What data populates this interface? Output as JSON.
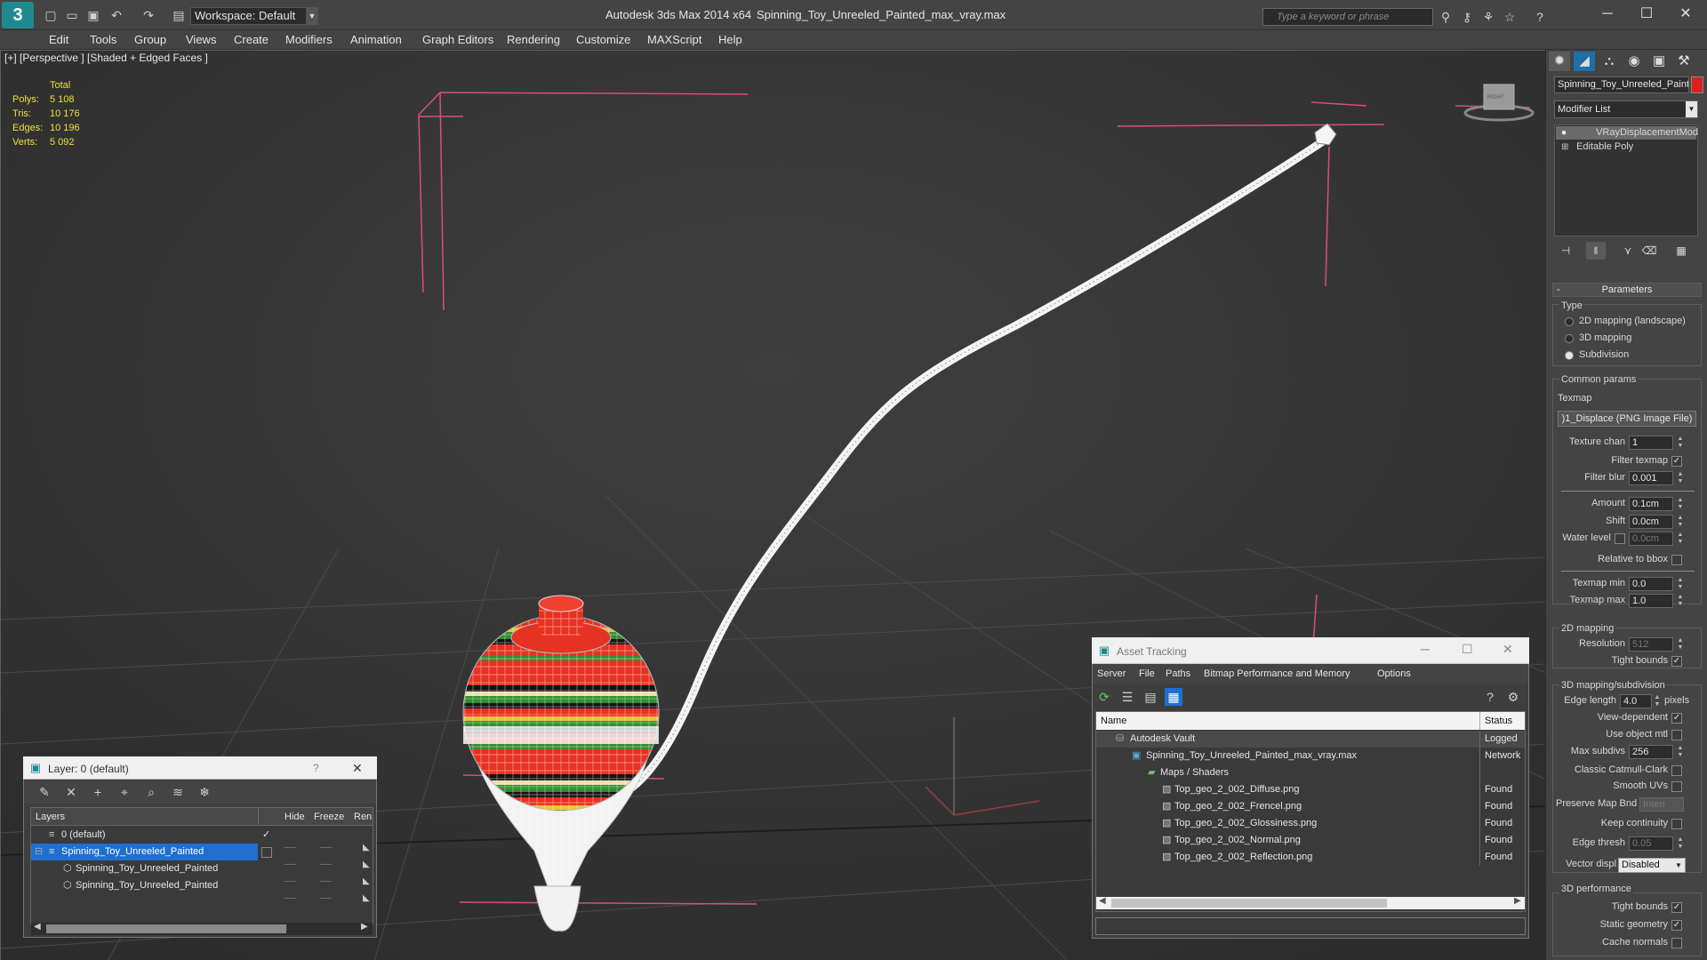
{
  "titlebar": {
    "workspace": "Workspace: Default",
    "app_title": "Autodesk 3ds Max  2014 x64",
    "file_title": "Spinning_Toy_Unreeled_Painted_max_vray.max",
    "search_placeholder": "Type a keyword or phrase"
  },
  "menu": [
    "Edit",
    "Tools",
    "Group",
    "Views",
    "Create",
    "Modifiers",
    "Animation",
    "Graph Editors",
    "Rendering",
    "Customize",
    "MAXScript",
    "Help"
  ],
  "viewport": {
    "label": "[+] [Perspective ] [Shaded + Edged Faces ]",
    "stats": {
      "header": "Total",
      "rows": [
        {
          "label": "Polys:",
          "value": "5 108"
        },
        {
          "label": "Tris:",
          "value": "10 176"
        },
        {
          "label": "Edges:",
          "value": "10 196"
        },
        {
          "label": "Verts:",
          "value": "5 092"
        }
      ]
    },
    "viewcube_label": "RIGHT"
  },
  "command_panel": {
    "object_name": "Spinning_Toy_Unreeled_Painted",
    "object_color": "#dc2020",
    "modifier_list": "Modifier List",
    "stack": [
      "VRayDisplacementMod",
      "Editable Poly"
    ],
    "parameters": {
      "title": "Parameters",
      "type_label": "Type",
      "type_options": [
        "2D mapping (landscape)",
        "3D mapping",
        "Subdivision"
      ],
      "common_params": "Common params",
      "texmap_label": "Texmap",
      "texmap_value": ")1_Displace (PNG Image File)",
      "texture_chan_label": "Texture chan",
      "texture_chan": "1",
      "filter_texmap": "Filter texmap",
      "filter_blur_label": "Filter blur",
      "filter_blur": "0.001",
      "amount_label": "Amount",
      "amount": "0.1cm",
      "shift_label": "Shift",
      "shift": "0.0cm",
      "water_level_label": "Water level",
      "water_level": "0.0cm",
      "relative_bbox": "Relative to bbox",
      "texmap_min_label": "Texmap min",
      "texmap_min": "0.0",
      "texmap_max_label": "Texmap max",
      "texmap_max": "1.0",
      "mapping_2d": "2D mapping",
      "resolution_label": "Resolution",
      "resolution": "512",
      "tight_bounds": "Tight bounds",
      "mapping_3d": "3D mapping/subdivision",
      "edge_length_label": "Edge length",
      "edge_length": "4.0",
      "pixels": "pixels",
      "view_dependent": "View-dependent",
      "use_object_mtl": "Use object mtl",
      "max_subdivs_label": "Max subdivs",
      "max_subdivs": "256",
      "catmull_clark": "Classic Catmull-Clark",
      "smooth_uvs": "Smooth UVs",
      "preserve_map_bnd": "Preserve Map Bnd",
      "preserve_map_value": "Interr",
      "keep_continuity": "Keep continuity",
      "edge_thresh_label": "Edge thresh",
      "edge_thresh": "0.05",
      "vector_displ_label": "Vector displ",
      "vector_displ": "Disabled",
      "performance": "3D performance",
      "tight_bounds2": "Tight bounds",
      "static_geometry": "Static geometry",
      "cache_normals": "Cache normals"
    }
  },
  "layer_dialog": {
    "title": "Layer: 0 (default)",
    "help": "?",
    "columns": [
      "Layers",
      "Hide",
      "Freeze",
      "Ren"
    ],
    "rows": [
      {
        "name": "0 (default)",
        "level": 0
      },
      {
        "name": "Spinning_Toy_Unreeled_Painted",
        "level": 0
      },
      {
        "name": "Spinning_Toy_Unreeled_Painted",
        "level": 1
      },
      {
        "name": "Spinning_Toy_Unreeled_Painted",
        "level": 1
      }
    ]
  },
  "asset_dialog": {
    "title": "Asset Tracking",
    "menu": [
      "Server",
      "File",
      "Paths",
      "Bitmap Performance and Memory",
      "Options"
    ],
    "columns": [
      "Name",
      "Status"
    ],
    "rows": [
      {
        "name": "Autodesk Vault",
        "status": "Logged",
        "level": 0
      },
      {
        "name": "Spinning_Toy_Unreeled_Painted_max_vray.max",
        "status": "Network",
        "level": 1
      },
      {
        "name": "Maps / Shaders",
        "status": "",
        "level": 2
      },
      {
        "name": "Top_geo_2_002_Diffuse.png",
        "status": "Found",
        "level": 3
      },
      {
        "name": "Top_geo_2_002_Frencel.png",
        "status": "Found",
        "level": 3
      },
      {
        "name": "Top_geo_2_002_Glossiness.png",
        "status": "Found",
        "level": 3
      },
      {
        "name": "Top_geo_2_002_Normal.png",
        "status": "Found",
        "level": 3
      },
      {
        "name": "Top_geo_2_002_Reflection.png",
        "status": "Found",
        "level": 3
      }
    ]
  }
}
